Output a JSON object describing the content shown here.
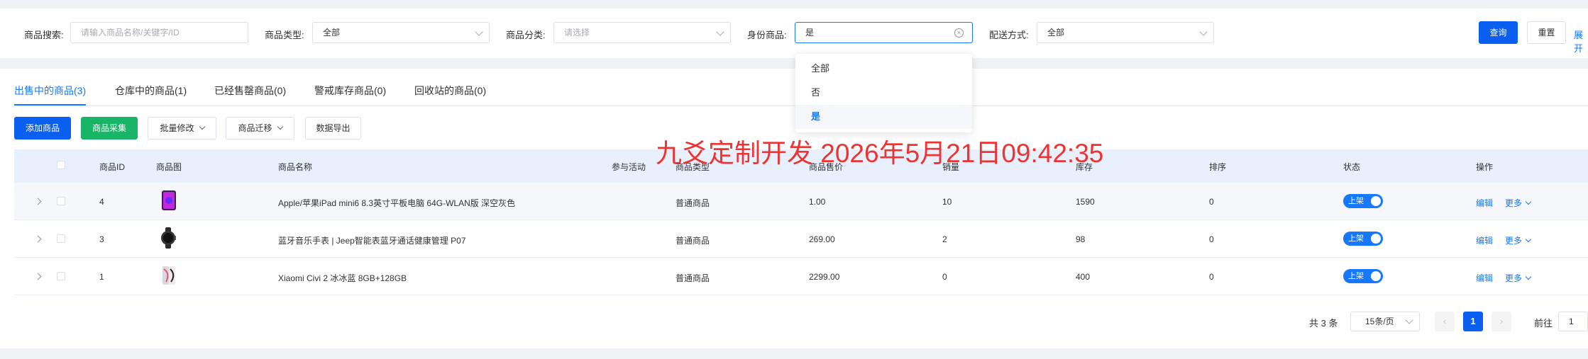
{
  "search": {
    "keyword_label": "商品搜索:",
    "keyword_placeholder": "请输入商品名称/关键字/ID",
    "type_label": "商品类型:",
    "type_value": "全部",
    "category_label": "商品分类:",
    "category_placeholder": "请选择",
    "identity_label": "身份商品:",
    "identity_value": "是",
    "delivery_label": "配送方式:",
    "delivery_value": "全部",
    "query_label": "查询",
    "reset_label": "重置",
    "expand_label": "展开"
  },
  "identity_dropdown": {
    "options": [
      "全部",
      "否",
      "是"
    ],
    "selected": "是"
  },
  "tabs": [
    {
      "label": "出售中的商品(3)",
      "active": true
    },
    {
      "label": "仓库中的商品(1)",
      "active": false
    },
    {
      "label": "已经售罄商品(0)",
      "active": false
    },
    {
      "label": "警戒库存商品(0)",
      "active": false
    },
    {
      "label": "回收站的商品(0)",
      "active": false
    }
  ],
  "toolbar": {
    "add_label": "添加商品",
    "collect_label": "商品采集",
    "batch_label": "批量修改",
    "migrate_label": "商品迁移",
    "export_label": "数据导出"
  },
  "table": {
    "columns": [
      "商品ID",
      "商品图",
      "商品名称",
      "参与活动",
      "商品类型",
      "商品售价",
      "销量",
      "库存",
      "排序",
      "状态",
      "操作"
    ],
    "rows": [
      {
        "id": "4",
        "name": "Apple/苹果iPad mini6 8.3英寸平板电脑 64G-WLAN版 深空灰色",
        "type": "普通商品",
        "price": "1.00",
        "sales": "10",
        "stock": "1590",
        "sort": "0",
        "status": "上架",
        "edit": "编辑",
        "more": "更多"
      },
      {
        "id": "3",
        "name": "蓝牙音乐手表 | Jeep智能表蓝牙通话健康管理 P07",
        "type": "普通商品",
        "price": "269.00",
        "sales": "2",
        "stock": "98",
        "sort": "0",
        "status": "上架",
        "edit": "编辑",
        "more": "更多"
      },
      {
        "id": "1",
        "name": "Xiaomi Civi 2 冰冰蓝 8GB+128GB",
        "type": "普通商品",
        "price": "2299.00",
        "sales": "0",
        "stock": "400",
        "sort": "0",
        "status": "上架",
        "edit": "编辑",
        "more": "更多"
      }
    ]
  },
  "pagination": {
    "total_label": "共 3 条",
    "page_size": "15条/页",
    "prev": "‹",
    "current_page": "1",
    "next": "›",
    "goto_label": "前往",
    "goto_value": "1"
  },
  "watermark": "九爻定制开发 2026年5月21日09:42:35",
  "colors": {
    "primary": "#0a5ef0",
    "green": "#18b566",
    "link": "#1677ff",
    "watermark": "#ee3333"
  }
}
